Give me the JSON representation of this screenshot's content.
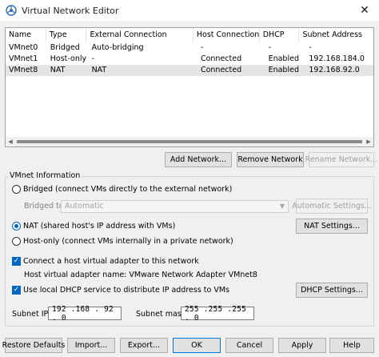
{
  "window": {
    "title": "Virtual Network Editor",
    "close_glyph": "✕"
  },
  "table": {
    "headers": [
      "Name",
      "Type",
      "External Connection",
      "Host Connection",
      "DHCP",
      "Subnet Address"
    ],
    "rows": [
      [
        "VMnet0",
        "Bridged",
        "Auto-bridging",
        "-",
        "-",
        "-"
      ],
      [
        "VMnet1",
        "Host-only",
        "-",
        "Connected",
        "Enabled",
        "192.168.184.0"
      ],
      [
        "VMnet8",
        "NAT",
        "NAT",
        "Connected",
        "Enabled",
        "192.168.92.0"
      ]
    ],
    "selected_row": 2
  },
  "network_buttons": {
    "add": "Add Network...",
    "remove": "Remove Network",
    "rename": "Rename Network..."
  },
  "vmnet_info": {
    "title": "VMnet Information",
    "bridged_label": "Bridged (connect VMs directly to the external network)",
    "bridged_to_label": "Bridged to:",
    "bridged_to_value": "Automatic",
    "auto_settings": "Automatic Settings...",
    "nat_label": "NAT (shared host's IP address with VMs)",
    "nat_settings": "NAT Settings...",
    "hostonly_label": "Host-only (connect VMs internally in a private network)",
    "connect_adapter_label": "Connect a host virtual adapter to this network",
    "adapter_name_label": "Host virtual adapter name: VMware Network Adapter VMnet8",
    "dhcp_label": "Use local DHCP service to distribute IP address to VMs",
    "dhcp_settings": "DHCP Settings...",
    "subnet_ip_label": "Subnet IP:",
    "subnet_ip_value": "192 .168 . 92 . 0",
    "subnet_mask_label": "Subnet mask:",
    "subnet_mask_value": "255 .255 .255 . 0",
    "selected_mode": "nat",
    "connect_adapter_checked": true,
    "dhcp_checked": true
  },
  "footer": {
    "restore": "Restore Defaults",
    "import": "Import...",
    "export": "Export...",
    "ok": "OK",
    "cancel": "Cancel",
    "apply": "Apply",
    "help": "Help"
  },
  "colors": {
    "accent": "#0067c0",
    "selection": "#e5e5e5"
  }
}
